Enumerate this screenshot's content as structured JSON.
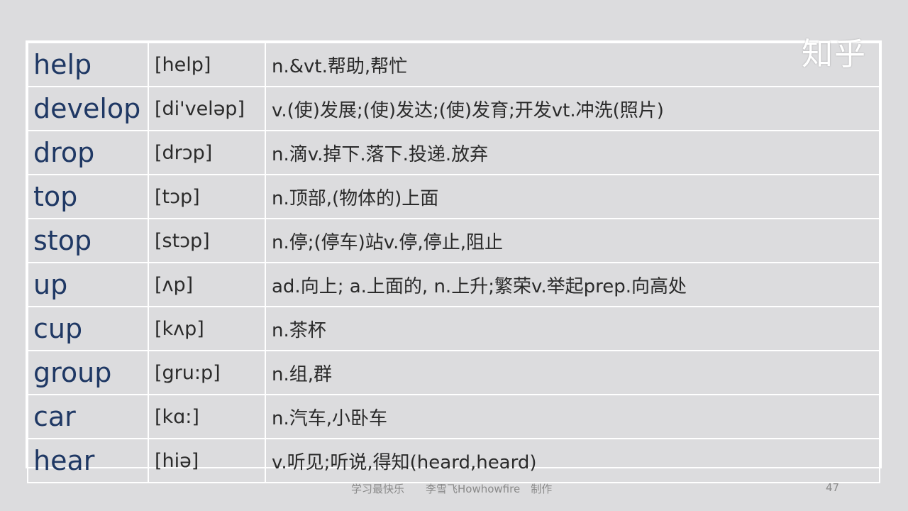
{
  "watermark": "知乎",
  "rows": [
    {
      "word": "help",
      "phonetic": "[help]",
      "meaning": "n.&vt.帮助,帮忙"
    },
    {
      "word": "develop",
      "phonetic": "[di'veləp]",
      "meaning": "v.(使)发展;(使)发达;(使)发育;开发vt.冲洗(照片)"
    },
    {
      "word": "drop",
      "phonetic": "[drɔp]",
      "meaning": "n.滴v.掉下.落下.投递.放弃"
    },
    {
      "word": "top",
      "phonetic": "[tɔp]",
      "meaning": "n.顶部,(物体的)上面"
    },
    {
      "word": "stop",
      "phonetic": "[stɔp]",
      "meaning": "n.停;(停车)站v.停,停止,阻止"
    },
    {
      "word": "up",
      "phonetic": "[ʌp]",
      "meaning": "ad.向上; a.上面的, n.上升;繁荣v.举起prep.向高处"
    },
    {
      "word": "cup",
      "phonetic": "[kʌp]",
      "meaning": "n.茶杯"
    },
    {
      "word": "group",
      "phonetic": "[gru:p]",
      "meaning": "n.组,群"
    },
    {
      "word": "car",
      "phonetic": "[kɑ:]",
      "meaning": "n.汽车,小卧车"
    },
    {
      "word": "hear",
      "phonetic": "[hiə]",
      "meaning": "v.听见;听说,得知(heard,heard)"
    }
  ],
  "footer": {
    "text": "学习最快乐　　李雪飞Howhowfire　制作",
    "page_number": "47"
  }
}
